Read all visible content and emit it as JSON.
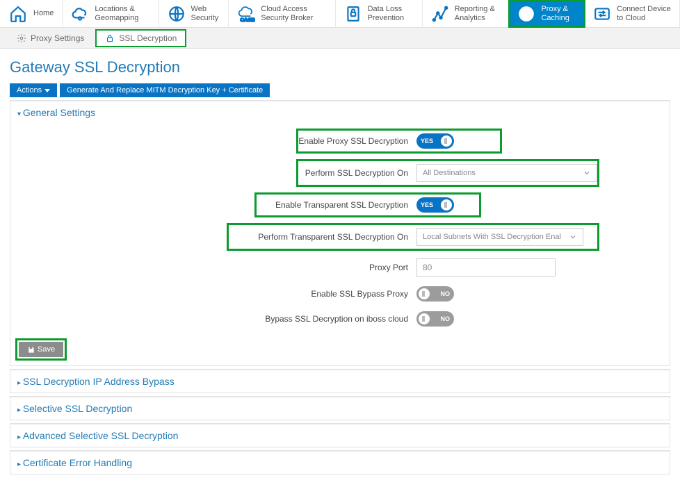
{
  "nav": [
    {
      "label": "Home",
      "icon": "home"
    },
    {
      "label": "Locations & Geomapping",
      "icon": "cloud"
    },
    {
      "label": "Web Security",
      "icon": "globe"
    },
    {
      "label": "Cloud Access Security Broker",
      "icon": "casb"
    },
    {
      "label": "Data Loss Prevention",
      "icon": "dlp"
    },
    {
      "label": "Reporting & Analytics",
      "icon": "chart"
    },
    {
      "label": "Proxy & Caching",
      "icon": "globe-arrow",
      "active": true
    },
    {
      "label": "Connect Device to Cloud",
      "icon": "arrows"
    }
  ],
  "subnav": {
    "proxy_settings": "Proxy Settings",
    "ssl_decryption": "SSL Decryption"
  },
  "page_title": "Gateway SSL Decryption",
  "actions": {
    "actions_label": "Actions",
    "generate_label": "Generate And Replace MITM Decryption Key + Certificate"
  },
  "panels": {
    "general_settings": "General Settings",
    "ip_bypass": "SSL Decryption IP Address Bypass",
    "selective": "Selective SSL Decryption",
    "adv_selective": "Advanced Selective SSL Decryption",
    "cert_error": "Certificate Error Handling"
  },
  "form": {
    "enable_proxy_label": "Enable Proxy SSL Decryption",
    "enable_proxy_state": "YES",
    "perform_on_label": "Perform SSL Decryption On",
    "perform_on_value": "All Destinations",
    "enable_transparent_label": "Enable Transparent SSL Decryption",
    "enable_transparent_state": "YES",
    "perform_transparent_label": "Perform Transparent SSL Decryption On",
    "perform_transparent_value": "Local Subnets With SSL Decryption Enal",
    "proxy_port_label": "Proxy Port",
    "proxy_port_value": "80",
    "bypass_proxy_label": "Enable SSL Bypass Proxy",
    "bypass_proxy_state": "NO",
    "bypass_cloud_label": "Bypass SSL Decryption on iboss cloud",
    "bypass_cloud_state": "NO"
  },
  "save_label": "Save"
}
